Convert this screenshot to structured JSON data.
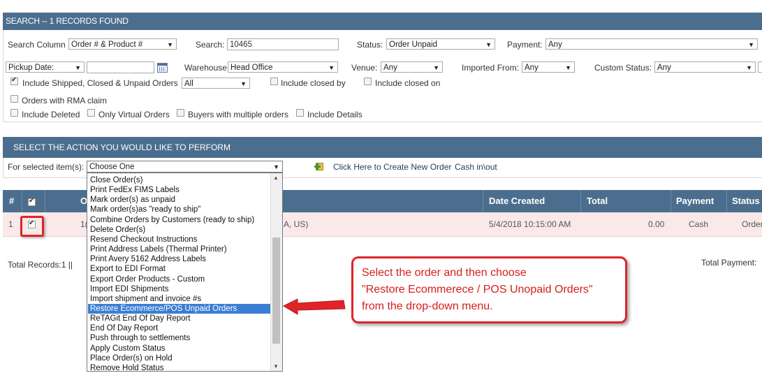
{
  "search_panel": {
    "title": "SEARCH -- 1 RECORDS FOUND",
    "search_column_label": "Search Column",
    "search_column_value": "Order # & Product #",
    "search_label": "Search:",
    "search_value": "10465",
    "status_label": "Status:",
    "status_value": "Order Unpaid",
    "payment_label": "Payment:",
    "payment_value": "Any",
    "pickup_date_value": "Pickup Date:",
    "warehouse_label": "Warehouse",
    "warehouse_value": "Head Office",
    "venue_label": "Venue:",
    "venue_value": "Any",
    "imported_from_label": "Imported From:",
    "imported_from_value": "Any",
    "custom_status_label": "Custom Status:",
    "custom_status_value": "Any",
    "include_shipped_label": "Include Shipped, Closed & Unpaid Orders",
    "include_shipped_value": "All",
    "include_closed_by_label": "Include closed by",
    "include_closed_on_label": "Include closed on",
    "orders_rma_label": "Orders with RMA claim",
    "include_deleted_label": "Include Deleted",
    "only_virtual_label": "Only Virtual Orders",
    "buyers_multiple_label": "Buyers with multiple orders",
    "include_details_label": "Include Details"
  },
  "action_panel": {
    "title": "SELECT THE ACTION YOU WOULD LIKE TO PERFORM",
    "for_selected_label": "For selected item(s):",
    "action_value": "Choose One",
    "create_order_link": "Click Here to Create New Order",
    "cash_link": "Cash in\\out"
  },
  "dropdown": {
    "items": [
      "Close Order(s)",
      "Print FedEx FIMS Labels",
      "Mark order(s) as unpaid",
      "Mark order(s)as \"ready to ship\"",
      "Combine Orders by Customers (ready to ship)",
      "Delete Order(s)",
      "Resend Checkout Instructions",
      "Print Address Labels (Thermal Printer)",
      "Print Avery 5162 Address Labels",
      "Export to EDI Format",
      "Export Order Products - Custom",
      "Import EDI Shipments",
      "Import shipment and invoice #s",
      "Restore Ecommerce/POS Unpaid Orders",
      "ReTAGit End Of Day Report",
      "End Of Day Report",
      "Push through to settlements",
      "Apply Custom Status",
      "Place Order(s) on Hold",
      "Remove Hold Status"
    ]
  },
  "table": {
    "headers": {
      "num": "#",
      "order": "O",
      "date_created": "Date Created",
      "total": "Total",
      "payment": "Payment",
      "status": "Status"
    },
    "row": {
      "num": "1",
      "order_fragment": "1(",
      "address_fragment": "A, US)",
      "date_created": "5/4/2018 10:15:00 AM",
      "total": "0.00",
      "payment": "Cash",
      "status": "Order"
    }
  },
  "footer": {
    "total_records": "Total Records:1 ||",
    "total_payments": "Total Payment:"
  },
  "callout": {
    "line1": "Select the order and then choose",
    "line2": "\"Restore Ecommerece / POS Unopaid Orders\"",
    "line3": "from the drop-down menu."
  },
  "colors": {
    "header_bg": "#4c6e8e",
    "row_bg": "#fbe9ea",
    "highlight_red": "#e0242a",
    "selection_blue": "#3b7fd4"
  }
}
